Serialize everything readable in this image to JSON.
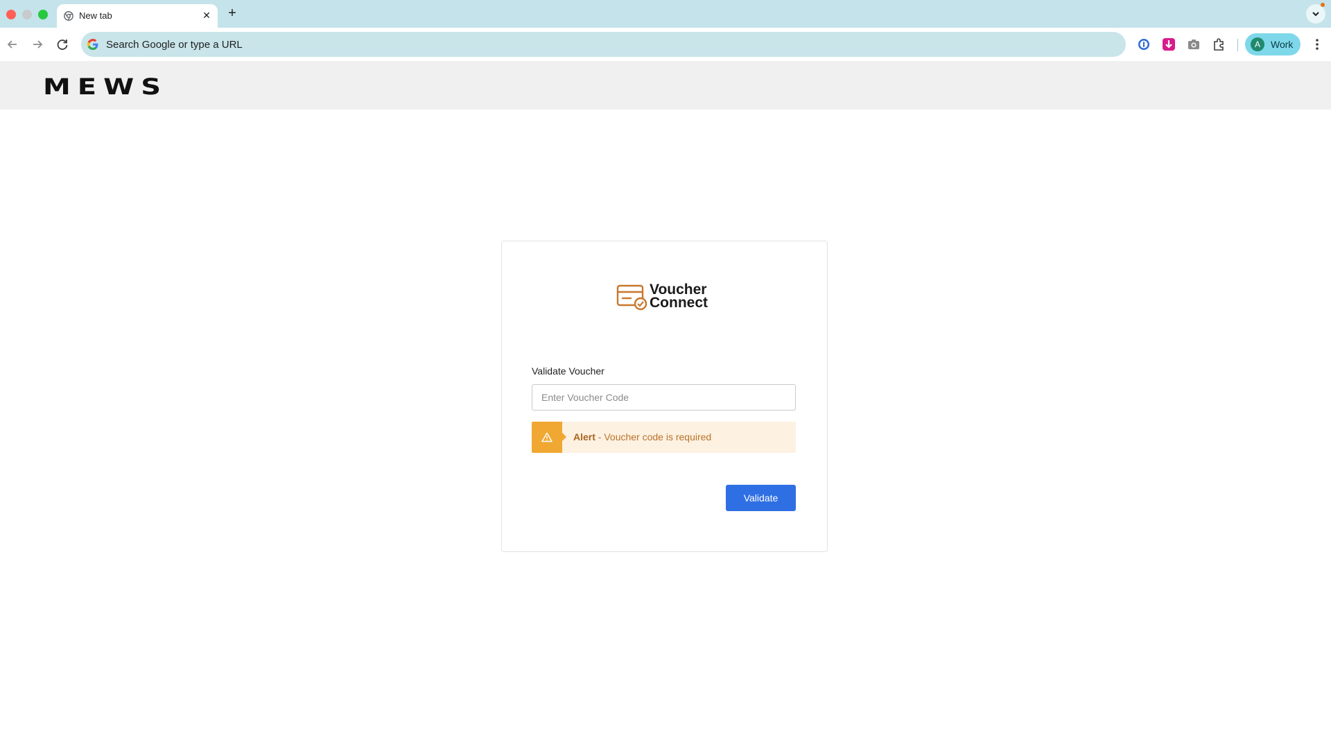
{
  "browser": {
    "tab": {
      "title": "New tab"
    },
    "omnibox": {
      "placeholder": "Search Google or type a URL"
    },
    "profile": {
      "initial": "A",
      "name": "Work"
    }
  },
  "site": {
    "brand": "MEWS"
  },
  "card": {
    "logo": {
      "line1": "Voucher",
      "line2": "Connect"
    },
    "form_label": "Validate Voucher",
    "input": {
      "placeholder": "Enter Voucher Code",
      "value": ""
    },
    "alert": {
      "title": "Alert",
      "message": " - Voucher code is required"
    },
    "button_label": "Validate"
  },
  "colors": {
    "accent": "#2f6fe4",
    "alert_bg": "#fdf1e1",
    "alert_icon_bg": "#f0a832",
    "logo_icon": "#c8772d"
  }
}
